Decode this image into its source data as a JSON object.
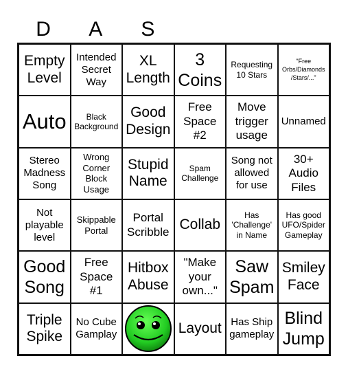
{
  "header": {
    "letters": [
      "D",
      "A",
      "S",
      "",
      "",
      ""
    ]
  },
  "board": {
    "cells": [
      {
        "text": "Empty\nLevel",
        "size": "s-l"
      },
      {
        "text": "Intended\nSecret\nWay",
        "size": "s-s"
      },
      {
        "text": "XL\nLength",
        "size": "s-l"
      },
      {
        "text": "3\nCoins",
        "size": "s-xl"
      },
      {
        "text": "Requesting\n10 Stars",
        "size": "s-xxs"
      },
      {
        "text": "\"Free\nOrbs/Diamonds\n/Stars/...\"",
        "size": "s-tiny"
      },
      {
        "text": "Auto",
        "size": "s-huge"
      },
      {
        "text": "Black\nBackground",
        "size": "s-xxs"
      },
      {
        "text": "Good\nDesign",
        "size": "s-l"
      },
      {
        "text": "Free\nSpace\n#2",
        "size": "s-m"
      },
      {
        "text": "Move\ntrigger\nusage",
        "size": "s-m"
      },
      {
        "text": "Unnamed",
        "size": "s-s"
      },
      {
        "text": "Stereo\nMadness\nSong",
        "size": "s-s"
      },
      {
        "text": "Wrong\nCorner\nBlock\nUsage",
        "size": "s-xs"
      },
      {
        "text": "Stupid\nName",
        "size": "s-l"
      },
      {
        "text": "Spam\nChallenge",
        "size": "s-xxs"
      },
      {
        "text": "Song not\nallowed\nfor use",
        "size": "s-s"
      },
      {
        "text": "30+\nAudio\nFiles",
        "size": "s-m"
      },
      {
        "text": "Not\nplayable\nlevel",
        "size": "s-s"
      },
      {
        "text": "Skippable\nPortal",
        "size": "s-xs"
      },
      {
        "text": "Portal\nScribble",
        "size": "s-m"
      },
      {
        "text": "Collab",
        "size": "s-l"
      },
      {
        "text": "Has\n'Challenge'\nin Name",
        "size": "s-xxs"
      },
      {
        "text": "Has good\nUFO/Spider\nGameplay",
        "size": "s-xxs"
      },
      {
        "text": "Good\nSong",
        "size": "s-xl"
      },
      {
        "text": "Free\nSpace\n#1",
        "size": "s-m"
      },
      {
        "text": "Hitbox\nAbuse",
        "size": "s-l"
      },
      {
        "text": "\"Make\nyour\nown...\"",
        "size": "s-m"
      },
      {
        "text": "Saw\nSpam",
        "size": "s-xl"
      },
      {
        "text": "Smiley\nFace",
        "size": "s-l"
      },
      {
        "text": "Triple\nSpike",
        "size": "s-l"
      },
      {
        "text": "No Cube\nGamplay",
        "size": "s-s"
      },
      {
        "text": "",
        "icon": "green-smiley-face-icon",
        "size": ""
      },
      {
        "text": "Layout",
        "size": "s-l"
      },
      {
        "text": "Has Ship\ngameplay",
        "size": "s-s"
      },
      {
        "text": "Blind\nJump",
        "size": "s-xl"
      }
    ]
  },
  "colors": {
    "grid_line": "#111111",
    "smiley_green": "#22cc22",
    "background": "#ffffff"
  }
}
